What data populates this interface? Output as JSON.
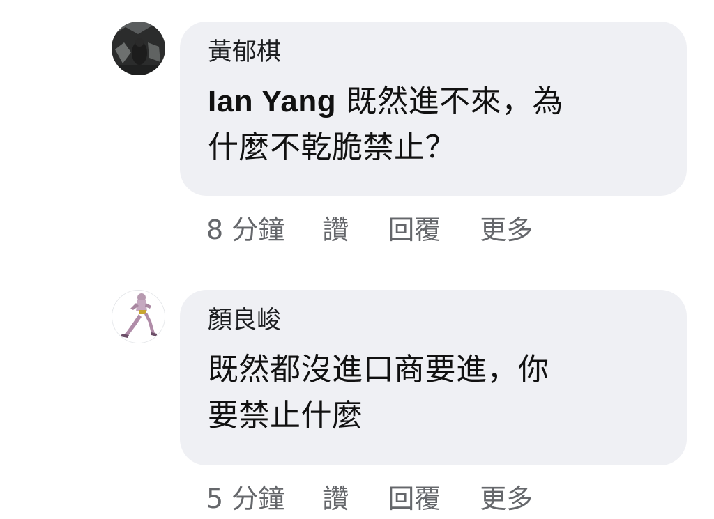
{
  "comments": [
    {
      "author": "黃郁棋",
      "mention": "Ian Yang",
      "text_line1": " 既然進不來，為",
      "text_line2": "什麼不乾脆禁止？",
      "time": "8 分鐘",
      "like_label": "讚",
      "reply_label": "回覆",
      "more_label": "更多"
    },
    {
      "author": "顏良峻",
      "text_line1": "既然都沒進口商要進，你",
      "text_line2": "要禁止什麼",
      "time": "5 分鐘",
      "like_label": "讚",
      "reply_label": "回覆",
      "more_label": "更多"
    }
  ],
  "colors": {
    "bubble": "#eff0f4",
    "meta_text": "#65676b",
    "body_text": "#111111"
  }
}
